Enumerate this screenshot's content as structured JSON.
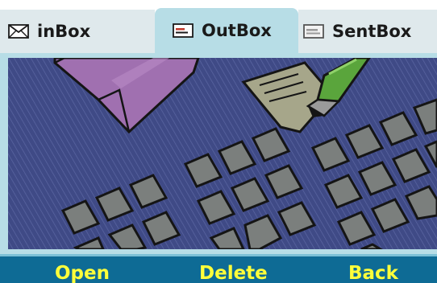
{
  "tabs": [
    {
      "label": "inBox",
      "icon": "envelope-icon",
      "selected": false
    },
    {
      "label": "OutBox",
      "icon": "outbox-card-icon",
      "selected": true
    },
    {
      "label": "SentBox",
      "icon": "sentbox-card-icon",
      "selected": false
    }
  ],
  "softkeys": {
    "left": "Open",
    "center": "Delete",
    "right": "Back"
  },
  "illustration": {
    "subject": "envelope, letter with pen, and phone keypad",
    "icons": [
      "envelope-icon",
      "letter-icon",
      "pen-icon",
      "keypad-icon"
    ]
  },
  "colors": {
    "tab_selected": "#b7dde6",
    "tab_unselected": "#dfe9ec",
    "content_frame": "#b7dde6",
    "illustration_bg": "#3f4a86",
    "softkey_bar": "#0e6b95",
    "softkey_text": "#ffff3a",
    "key_gray": "#7b7f7d",
    "envelope_purple": "#a070b0",
    "paper_olive": "#a6a68a",
    "pen_green": "#5aa53c"
  }
}
